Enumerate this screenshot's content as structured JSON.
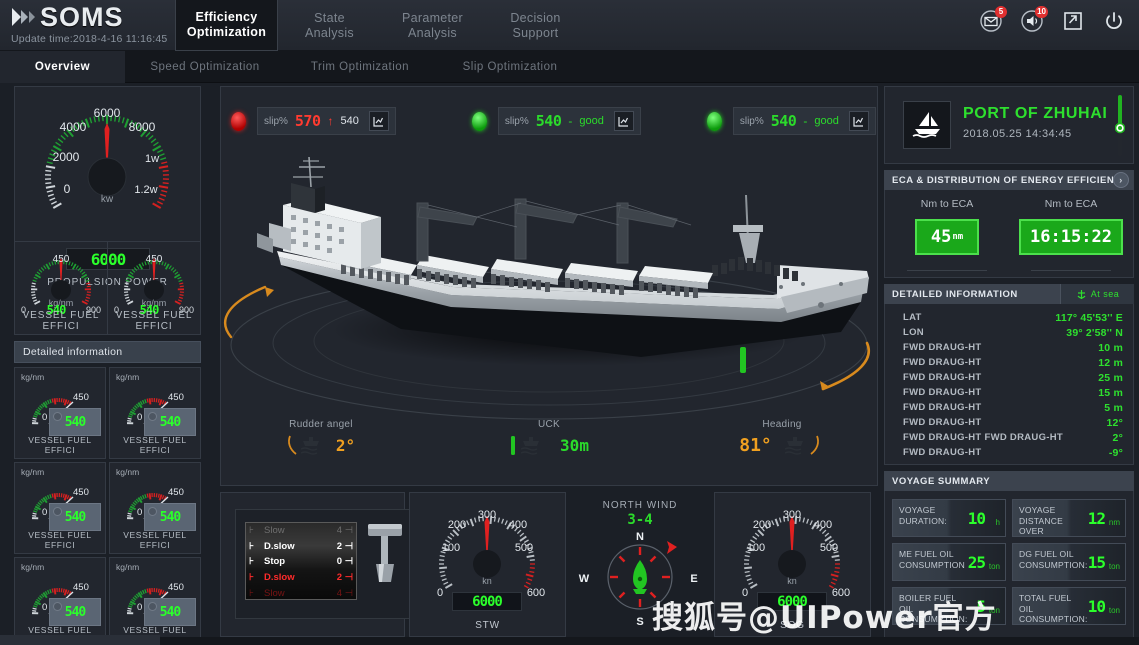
{
  "header": {
    "logo_text": "SOMS",
    "logo_icon": "double-chevron-icon",
    "update_time": "Update time:2018-4-16 11:16:45",
    "nav": [
      {
        "line1": "Efficiency",
        "line2": "Optimization",
        "active": true
      },
      {
        "line1": "State",
        "line2": "Analysis",
        "active": false
      },
      {
        "line1": "Parameter",
        "line2": "Analysis",
        "active": false
      },
      {
        "line1": "Decision",
        "line2": "Support",
        "active": false
      }
    ],
    "icons": [
      {
        "name": "mail-icon",
        "badge": "5"
      },
      {
        "name": "volume-icon",
        "badge": "10"
      },
      {
        "name": "export-icon",
        "badge": ""
      },
      {
        "name": "power-icon",
        "badge": ""
      }
    ]
  },
  "subtabs": [
    {
      "label": "Overview",
      "active": true
    },
    {
      "label": "Speed Optimization",
      "active": false
    },
    {
      "label": "Trim Optimization",
      "active": false
    },
    {
      "label": "Slip Optimization",
      "active": false
    }
  ],
  "left": {
    "main_gauge": {
      "caption": "PROPULSION POWER",
      "unit": "kw",
      "value": "6000",
      "ticks": [
        "0",
        "2000",
        "4000",
        "6000",
        "8000",
        "1w",
        "1.2w"
      ]
    },
    "twin": [
      {
        "caption": "VESSEL FUEL EFFICI",
        "unit": "kg/nm",
        "min": "0",
        "mid": "450",
        "max": "900",
        "value": "540"
      },
      {
        "caption": "VESSEL FUEL EFFICI",
        "unit": "kg/nm",
        "min": "0",
        "mid": "450",
        "max": "900",
        "value": "540"
      }
    ],
    "detail_header": "Detailed information",
    "mini_gauges": [
      {
        "caption": "VESSEL FUEL EFFICI",
        "unit": "kg/nm",
        "min": "0",
        "max": "450",
        "value": "540"
      },
      {
        "caption": "VESSEL FUEL EFFICI",
        "unit": "kg/nm",
        "min": "0",
        "max": "450",
        "value": "540"
      },
      {
        "caption": "VESSEL FUEL EFFICI",
        "unit": "kg/nm",
        "min": "0",
        "max": "450",
        "value": "540"
      },
      {
        "caption": "VESSEL FUEL EFFICI",
        "unit": "kg/nm",
        "min": "0",
        "max": "450",
        "value": "540"
      },
      {
        "caption": "VESSEL FUEL EFFICI",
        "unit": "kg/nm",
        "min": "0",
        "max": "450",
        "value": "540"
      },
      {
        "caption": "VESSEL FUEL EFFICI",
        "unit": "kg/nm",
        "min": "0",
        "max": "450",
        "value": "540"
      }
    ]
  },
  "middle": {
    "slip_indicators": [
      {
        "led": "red",
        "label": "slip%",
        "value": "570",
        "arrow": "↑",
        "compare": "540",
        "status_color": "#ff3b30"
      },
      {
        "led": "green",
        "label": "slip%",
        "value": "540",
        "arrow": "-",
        "compare": "good",
        "status_color": "#2bdb2b"
      },
      {
        "led": "green",
        "label": "slip%",
        "value": "540",
        "arrow": "-",
        "compare": "good",
        "status_color": "#2bdb2b"
      }
    ],
    "metrics": [
      {
        "label": "Rudder angel",
        "value": "2°",
        "color": "#f0a020",
        "icon": "ship-top-icon"
      },
      {
        "label": "UCK",
        "value": "30m",
        "color": "#2bdb2b",
        "icon": "ship-depth-icon"
      },
      {
        "label": "Heading",
        "value": "81°",
        "color": "#f0a020",
        "icon": "ship-heading-icon"
      }
    ],
    "telegraph": {
      "rows": [
        {
          "name": "Slow",
          "num": "4",
          "state": "dim-top"
        },
        {
          "name": "D.slow",
          "num": "2",
          "state": "white"
        },
        {
          "name": "Stop",
          "num": "0",
          "state": "white"
        },
        {
          "name": "D.slow",
          "num": "2",
          "state": "red"
        },
        {
          "name": "Slow",
          "num": "4",
          "state": "dim-red"
        }
      ]
    },
    "stw_gauge": {
      "caption": "STW",
      "unit": "kn",
      "value": "6000",
      "ticks": [
        "0",
        "100",
        "200",
        "300",
        "400",
        "500",
        "600"
      ]
    },
    "wind": {
      "title": "NORTH WIND",
      "value": "3-4",
      "points": {
        "n": "N",
        "e": "E",
        "s": "S",
        "w": "W"
      }
    },
    "sog_gauge": {
      "caption": "SOG",
      "unit": "kn",
      "value": "6000",
      "ticks": [
        "0",
        "100",
        "200",
        "300",
        "400",
        "500",
        "600"
      ]
    }
  },
  "right": {
    "port": {
      "name": "PORT OF ZHUHAI",
      "datetime": "2018.05.25 14:34:45",
      "icon": "sailboat-icon"
    },
    "eca": {
      "header": "ECA & DISTRIBUTION OF ENERGY EFFICIENCY",
      "cells": [
        {
          "label": "Nm to ECA",
          "value": "45",
          "unit": "nm"
        },
        {
          "label": "Nm to ECA",
          "value": "16:15:22",
          "unit": ""
        }
      ]
    },
    "detailed": {
      "header": "DETAILED INFORMATION",
      "badge": "At sea",
      "badge_icon": "anchor-icon",
      "rows": [
        {
          "key": "LAT",
          "value": "117° 45'53'' E"
        },
        {
          "key": "LON",
          "value": "39°  2'58'' N"
        },
        {
          "key": "FWD DRAUG-HT",
          "value": "10 m"
        },
        {
          "key": "FWD DRAUG-HT",
          "value": "12 m"
        },
        {
          "key": "FWD DRAUG-HT",
          "value": "25 m"
        },
        {
          "key": "FWD DRAUG-HT",
          "value": "15 m"
        },
        {
          "key": "FWD DRAUG-HT",
          "value": "5 m"
        },
        {
          "key": "FWD DRAUG-HT",
          "value": "12°"
        },
        {
          "key": "FWD DRAUG-HT FWD DRAUG-HT",
          "value": "2°"
        },
        {
          "key": "FWD DRAUG-HT",
          "value": "-9°"
        }
      ]
    },
    "voyage": {
      "header": "VOYAGE SUMMARY",
      "cards": [
        {
          "label": "VOYAGE DURATION:",
          "value": "10",
          "unit": "h"
        },
        {
          "label": "VOYAGE DISTANCE OVER GROUND:",
          "value": "12",
          "unit": "nm"
        },
        {
          "label": "ME FUEL OIL CONSUMPTION",
          "value": "25",
          "unit": "ton"
        },
        {
          "label": "DG FUEL OIL CONSUMPTION:",
          "value": "15",
          "unit": "ton"
        },
        {
          "label": "BOILER FUEL OIL CONSUMPTION:",
          "value": "5",
          "unit": "ton"
        },
        {
          "label": "TOTAL FUEL OIL CONSUMPTION:",
          "value": "10",
          "unit": "ton"
        }
      ]
    }
  },
  "watermark": "搜狐号@UIPower官方"
}
